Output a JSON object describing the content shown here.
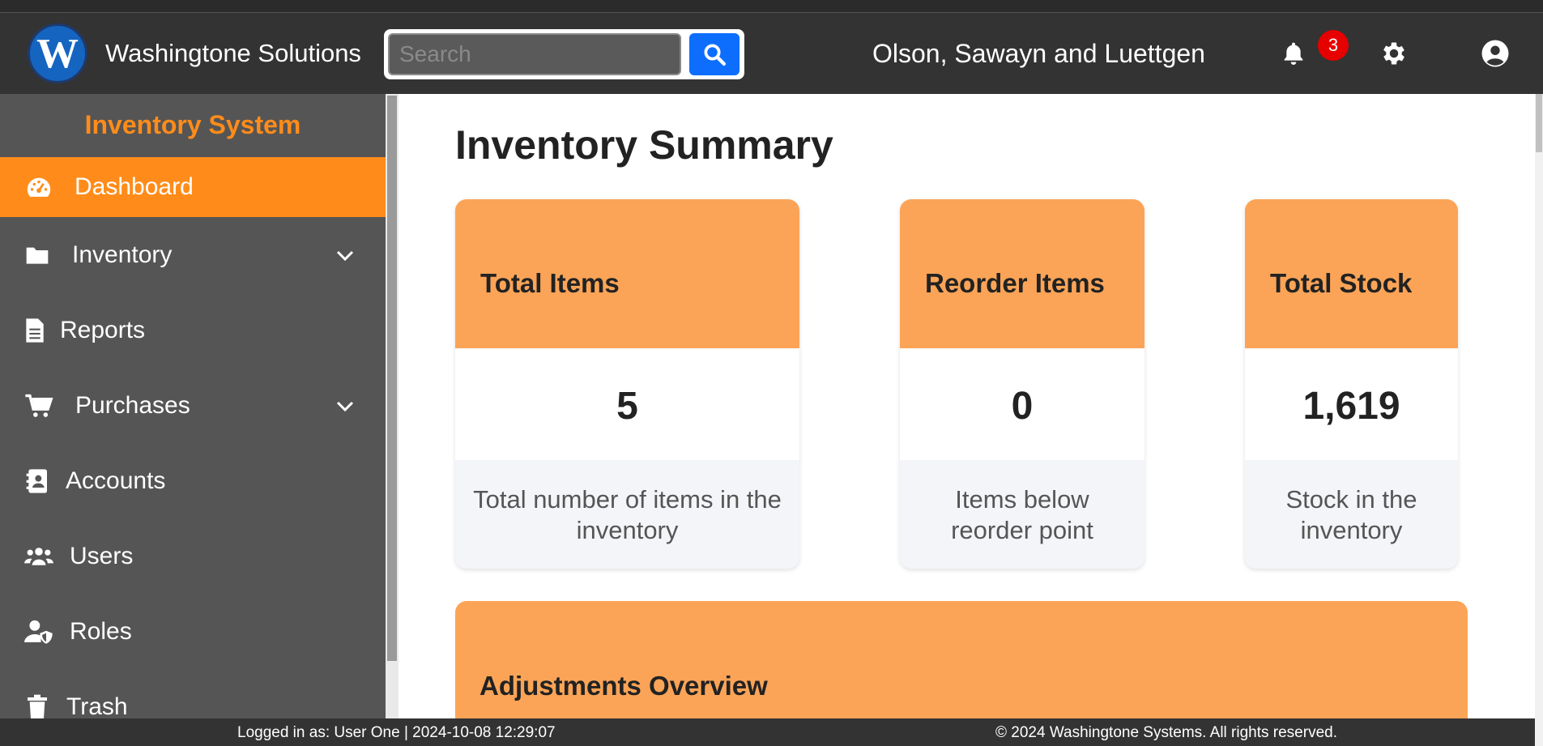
{
  "header": {
    "logo_letter": "W",
    "brand": "Washingtone Solutions",
    "search_placeholder": "Search",
    "company": "Olson, Sawayn and Luettgen",
    "notification_count": "3"
  },
  "sidebar": {
    "title": "Inventory System",
    "items": [
      {
        "label": "Dashboard",
        "icon": "gauge-icon",
        "active": true
      },
      {
        "label": "Inventory",
        "icon": "folder-icon",
        "has_dropdown": true
      },
      {
        "label": "Reports",
        "icon": "document-icon"
      },
      {
        "label": "Purchases",
        "icon": "cart-icon",
        "has_dropdown": true
      },
      {
        "label": "Accounts",
        "icon": "contact-card-icon"
      },
      {
        "label": "Users",
        "icon": "users-icon"
      },
      {
        "label": "Roles",
        "icon": "user-shield-icon"
      },
      {
        "label": "Trash",
        "icon": "trash-icon"
      }
    ]
  },
  "main": {
    "title": "Inventory Summary",
    "cards": [
      {
        "title": "Total Items",
        "value": "5",
        "description": "Total number of items in the inventory"
      },
      {
        "title": "Reorder Items",
        "value": "0",
        "description": "Items below reorder point"
      },
      {
        "title": "Total Stock",
        "value": "1,619",
        "description": "Stock in the inventory"
      }
    ],
    "section_title": "Adjustments Overview"
  },
  "footer": {
    "logged_in": "Logged in as: User One | 2024-10-08 12:29:07",
    "copyright": "© 2024 Washingtone Systems. All rights reserved."
  },
  "colors": {
    "accent": "#ff8c1a",
    "card_header": "#fba457",
    "topbar": "#333333",
    "sidebar": "#555555",
    "search_button": "#0d6efd",
    "badge": "#e60000"
  }
}
